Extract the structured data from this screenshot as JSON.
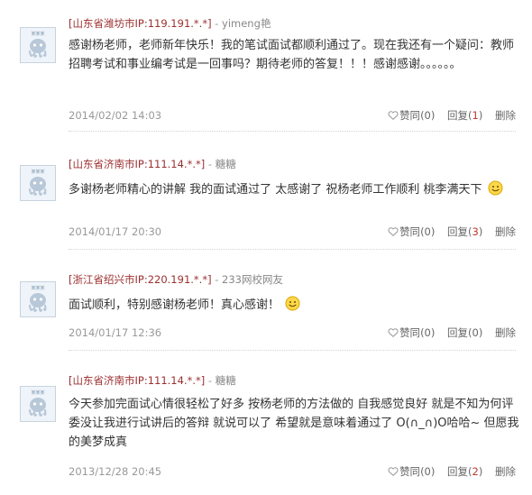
{
  "comments": [
    {
      "location": "[山东省潍坊市",
      "ip": "IP:119.191.*.*]",
      "separator": "-",
      "username": "yimeng艳",
      "avatar_text": "某某某",
      "content": "感谢杨老师，老师新年快乐！我的笔试面试都顺利通过了。现在我还有一个疑问：教师招聘考试和事业编考试是一回事吗？期待老师的答复！！！感谢感谢。。。。。。",
      "has_smile": false,
      "date": "2014/02/02 14:03",
      "like_label": "赞同",
      "like_count": "(0)",
      "reply_label": "回复",
      "reply_open": "(",
      "reply_count": "1",
      "reply_close": ")",
      "reply_highlight": true,
      "delete_label": "删除"
    },
    {
      "location": "[山东省济南市",
      "ip": "IP:111.14.*.*]",
      "separator": "-",
      "username": "糖糖",
      "avatar_text": "某某某",
      "content": "多谢杨老师精心的讲解 我的面试通过了 太感谢了 祝杨老师工作顺利 桃李满天下",
      "has_smile": true,
      "date": "2014/01/17 20:30",
      "like_label": "赞同",
      "like_count": "(0)",
      "reply_label": "回复",
      "reply_open": "(",
      "reply_count": "3",
      "reply_close": ")",
      "reply_highlight": true,
      "delete_label": "删除"
    },
    {
      "location": "[浙江省绍兴市",
      "ip": "IP:220.191.*.*]",
      "separator": "-",
      "username": "233网校网友",
      "avatar_text": "某某某",
      "content": "面试顺利，特别感谢杨老师！真心感谢！",
      "has_smile": true,
      "date": "2014/01/17 12:36",
      "like_label": "赞同",
      "like_count": "(0)",
      "reply_label": "回复",
      "reply_open": "(",
      "reply_count": "0",
      "reply_close": ")",
      "reply_highlight": false,
      "delete_label": "删除"
    },
    {
      "location": "[山东省济南市",
      "ip": "IP:111.14.*.*]",
      "separator": "-",
      "username": "糖糖",
      "avatar_text": "某某某",
      "content": "今天参加完面试心情很轻松了好多 按杨老师的方法做的 自我感觉良好 就是不知为何评委没让我进行试讲后的答辩 就说可以了 希望就是意味着通过了 O(∩_∩)O哈哈~ 但愿我的美梦成真",
      "has_smile": false,
      "date": "2013/12/28 20:45",
      "like_label": "赞同",
      "like_count": "(0)",
      "reply_label": "回复",
      "reply_open": "(",
      "reply_count": "2",
      "reply_close": ")",
      "reply_highlight": true,
      "delete_label": "删除"
    }
  ],
  "colors": {
    "location": "#9c2f2f",
    "username": "#888888",
    "reply_count": "#c0392b",
    "divider": "#d4d4d4"
  }
}
